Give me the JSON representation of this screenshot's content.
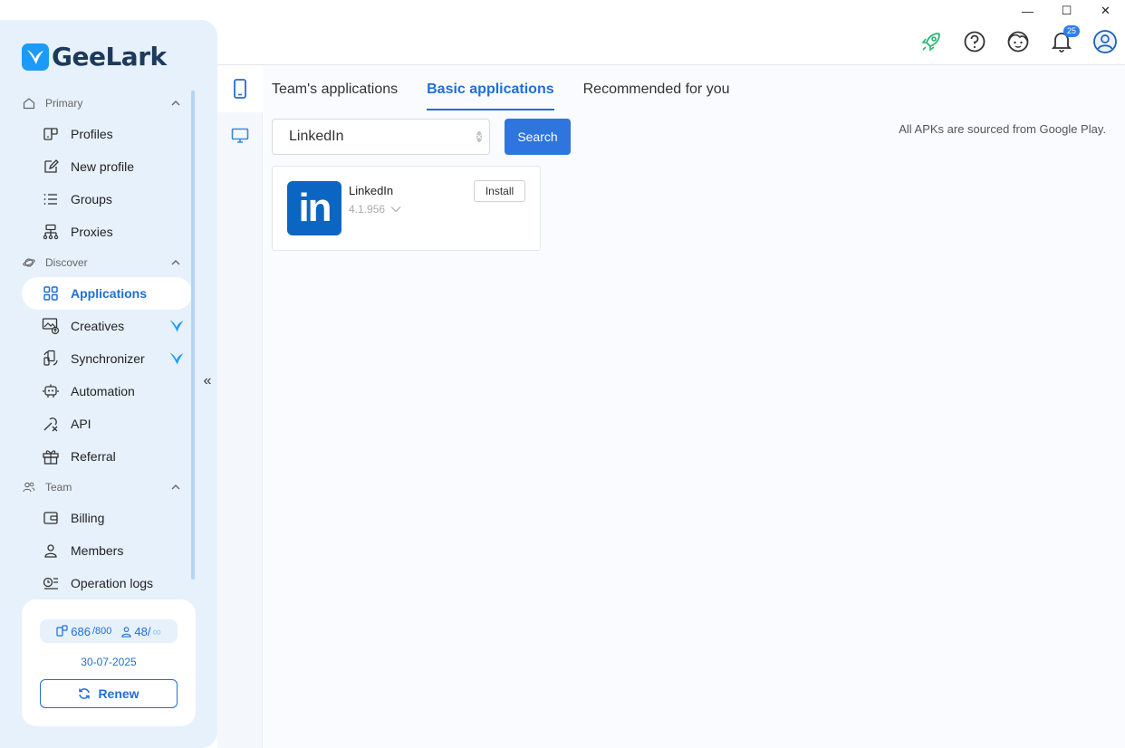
{
  "window": {
    "minimize": "—",
    "maximize": "☐",
    "close": "✕"
  },
  "brand": {
    "name": "GeeLark"
  },
  "sidebar": {
    "sections": [
      {
        "label": "Primary",
        "items": [
          {
            "label": "Profiles"
          },
          {
            "label": "New profile"
          },
          {
            "label": "Groups"
          },
          {
            "label": "Proxies"
          }
        ]
      },
      {
        "label": "Discover",
        "items": [
          {
            "label": "Applications"
          },
          {
            "label": "Creatives"
          },
          {
            "label": "Synchronizer"
          },
          {
            "label": "Automation"
          },
          {
            "label": "API"
          },
          {
            "label": "Referral"
          }
        ]
      },
      {
        "label": "Team",
        "items": [
          {
            "label": "Billing"
          },
          {
            "label": "Members"
          },
          {
            "label": "Operation logs"
          }
        ]
      }
    ],
    "collapse_glyph": "«"
  },
  "plan": {
    "profiles_used": "686",
    "profiles_total": "/800",
    "members_used": "48/",
    "members_total": "∞",
    "expiry_date": "30-07-2025",
    "renew_label": "Renew"
  },
  "header": {
    "notification_count": "25"
  },
  "tabs": [
    {
      "label": "Team's applications"
    },
    {
      "label": "Basic applications"
    },
    {
      "label": "Recommended for you"
    }
  ],
  "search": {
    "value": "LinkedIn",
    "button_label": "Search"
  },
  "source_note": "All APKs are sourced from Google Play.",
  "apps": [
    {
      "name": "LinkedIn",
      "version": "4.1.956",
      "install_label": "Install",
      "logo_text": "in"
    }
  ],
  "colors": {
    "accent": "#1f6fd6",
    "sidebar_bg": "#e6f1fc",
    "linkedin": "#0a66c2",
    "rocket": "#2bb673"
  }
}
